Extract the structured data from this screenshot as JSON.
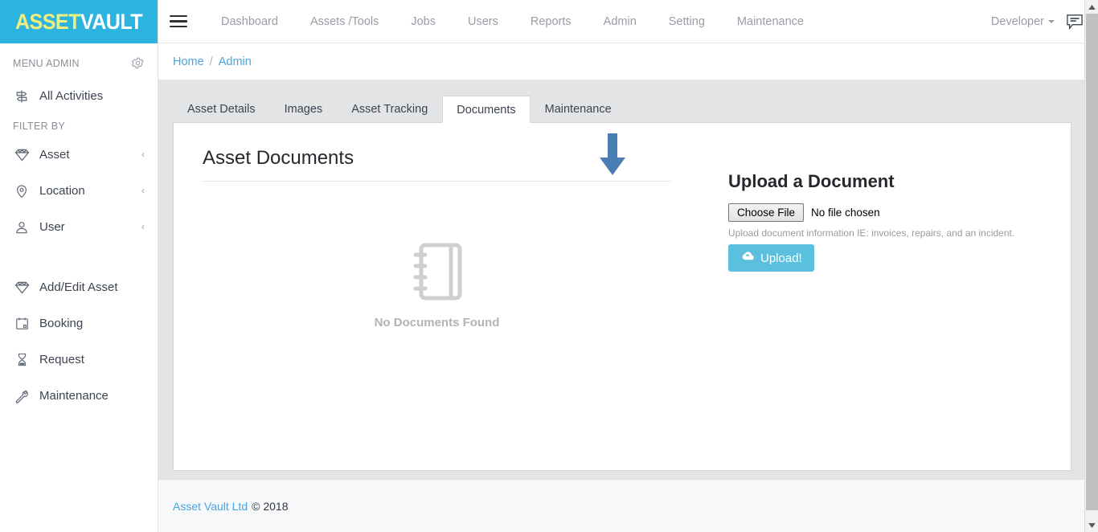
{
  "brand": {
    "logo_part1": "ASSET",
    "logo_part2": "VAULT",
    "logo_bg": "#2cb3e0",
    "logo_part1_color": "#f2ee79",
    "logo_part2_color": "#ffffff"
  },
  "sidebar": {
    "menu_label": "MENU ADMIN",
    "gear_icon": "gear-icon",
    "filter_label": "FILTER BY",
    "top_items": [
      {
        "label": "All Activities",
        "icon": "signpost-icon",
        "chevron": ""
      }
    ],
    "filter_items": [
      {
        "label": "Asset",
        "icon": "diamond-icon",
        "chevron": "‹"
      },
      {
        "label": "Location",
        "icon": "map-pin-icon",
        "chevron": "‹"
      },
      {
        "label": "User",
        "icon": "user-icon",
        "chevron": "‹"
      }
    ],
    "bottom_items": [
      {
        "label": "Add/Edit Asset",
        "icon": "diamond-icon",
        "chevron": ""
      },
      {
        "label": "Booking",
        "icon": "calendar-icon",
        "chevron": ""
      },
      {
        "label": "Request",
        "icon": "hourglass-icon",
        "chevron": ""
      },
      {
        "label": "Maintenance",
        "icon": "wrench-icon",
        "chevron": ""
      }
    ]
  },
  "topbar": {
    "menu_toggle_icon": "hamburger-icon",
    "nav": [
      {
        "label": "Dashboard"
      },
      {
        "label": "Assets /Tools"
      },
      {
        "label": "Jobs"
      },
      {
        "label": "Users"
      },
      {
        "label": "Reports"
      },
      {
        "label": "Admin"
      },
      {
        "label": "Setting"
      },
      {
        "label": "Maintenance"
      }
    ],
    "user_label": "Developer",
    "chat_icon": "comment-icon"
  },
  "breadcrumb": {
    "home": "Home",
    "separator": "/",
    "current": "Admin"
  },
  "tabs": [
    {
      "label": "Asset Details",
      "active": false
    },
    {
      "label": "Images",
      "active": false
    },
    {
      "label": "Asset Tracking",
      "active": false
    },
    {
      "label": "Documents",
      "active": true
    },
    {
      "label": "Maintenance",
      "active": false
    }
  ],
  "annotation": {
    "type": "down-arrow",
    "color": "#4a7fb5",
    "points_to": "Documents"
  },
  "content": {
    "heading": "Asset Documents",
    "empty_state": {
      "icon": "notebook-icon",
      "label": "No Documents Found",
      "color": "#cfcfcf"
    }
  },
  "upload": {
    "heading": "Upload a Document",
    "choose_file_label": "Choose File",
    "file_status": "No file chosen",
    "hint": "Upload document information IE: invoices, repairs, and an incident.",
    "button_label": "Upload!",
    "button_icon": "cloud-upload-icon",
    "button_color": "#5bc0de"
  },
  "footer": {
    "link": "Asset Vault Ltd",
    "copyright": "© 2018"
  }
}
